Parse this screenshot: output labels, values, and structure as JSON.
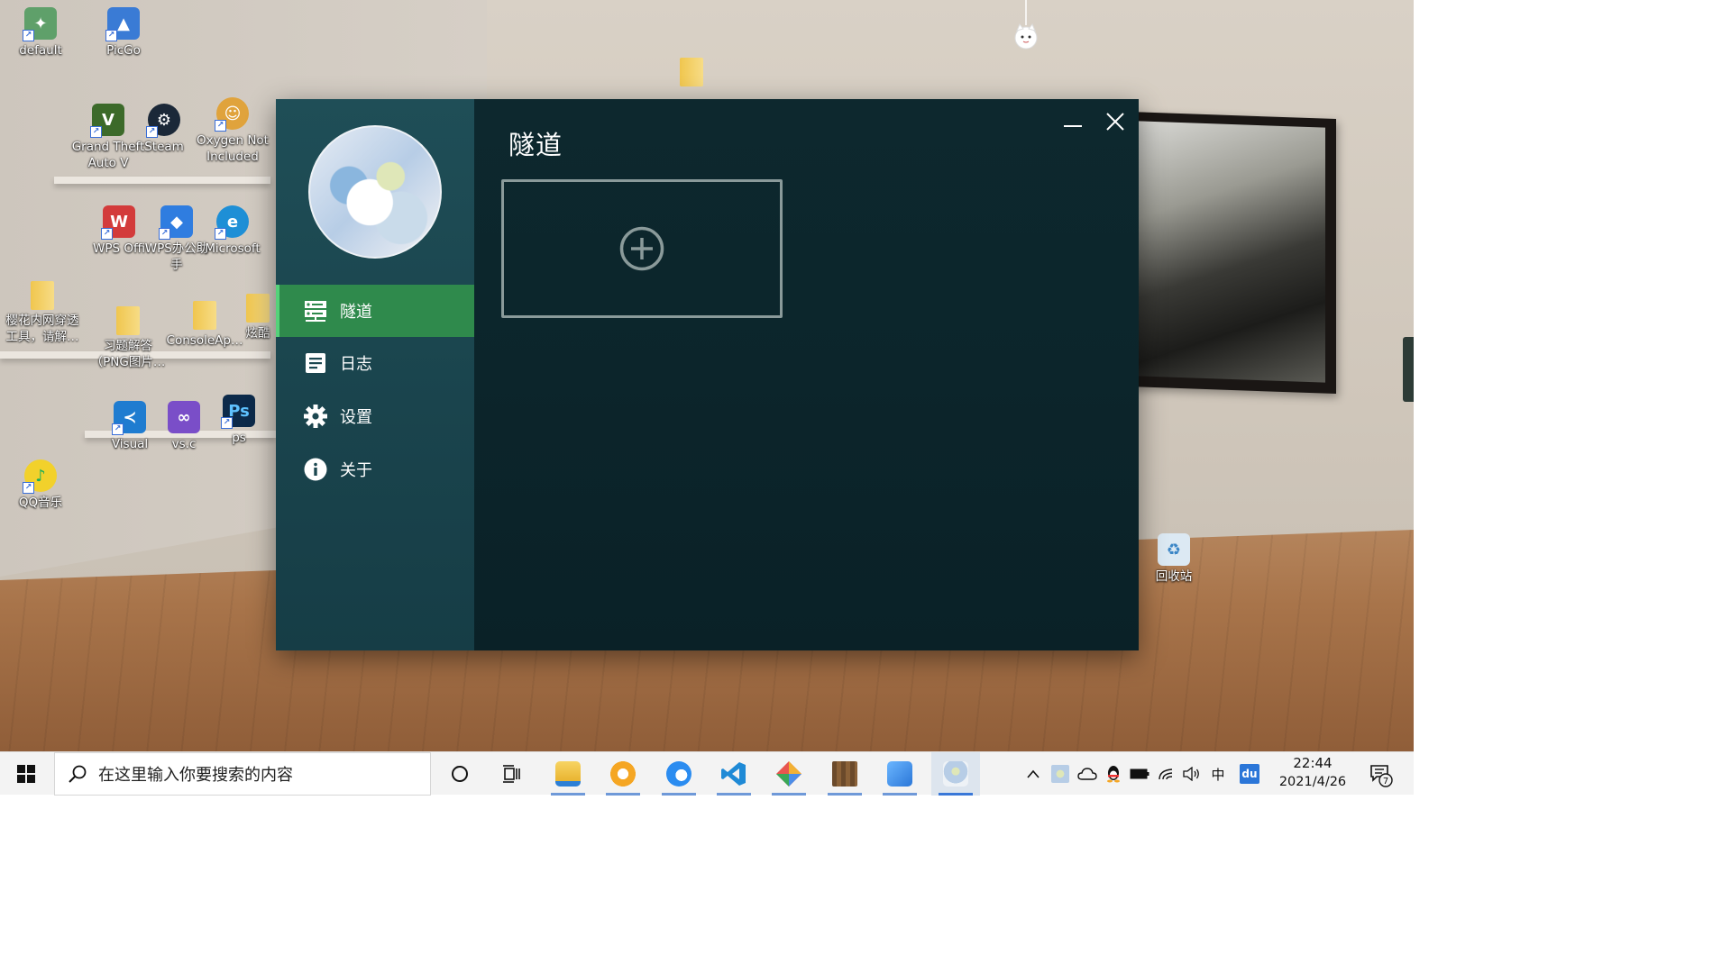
{
  "desktop": {
    "icons": [
      {
        "label": "default",
        "color": "#5fa06a"
      },
      {
        "label": "PicGo",
        "color": "#3a7bd5"
      },
      {
        "label": "Grand Theft Auto V",
        "color": "#3c6a2a"
      },
      {
        "label": "Steam",
        "color": "#1b2838"
      },
      {
        "label": "Oxygen Not Included",
        "color": "#e0a33c"
      },
      {
        "label": "WPS Offi",
        "color": "#d33b3b"
      },
      {
        "label": "WPS办公助手",
        "color": "#2f7de0"
      },
      {
        "label": "Microsoft",
        "color": "#1e8fd6"
      },
      {
        "label": "樱花内网穿透工具，请解…",
        "color": "#f3cf6b"
      },
      {
        "label": "习题解答（PNG图片…",
        "color": "#f3cf6b"
      },
      {
        "label": "ConsoleAp…",
        "color": "#f3cf6b"
      },
      {
        "label": "炫酷",
        "color": "#f3cf6b"
      },
      {
        "label": "Visual",
        "color": "#1f7cd0"
      },
      {
        "label": "vs.c",
        "color": "#7a4ec8"
      },
      {
        "label": "ps",
        "color": "#0c2a4a"
      },
      {
        "label": "QQ音乐",
        "color": "#f2d12b"
      },
      {
        "label": "回收站",
        "color": "#cfe3f2"
      }
    ]
  },
  "app": {
    "page_title": "隧道",
    "nav": [
      {
        "label": "隧道",
        "icon": "server-icon",
        "active": true
      },
      {
        "label": "日志",
        "icon": "document-icon",
        "active": false
      },
      {
        "label": "设置",
        "icon": "gear-icon",
        "active": false
      },
      {
        "label": "关于",
        "icon": "info-icon",
        "active": false
      }
    ],
    "colors": {
      "sidebar": "#1f4e57",
      "main": "#0c252b",
      "accent_active": "#2f8a4c",
      "card_border": "#8a9a9a"
    }
  },
  "taskbar": {
    "search_placeholder": "在这里输入你要搜索的内容",
    "apps": [
      "file-explorer",
      "qq-browser",
      "edge",
      "vscode",
      "sourcetree",
      "minecraft",
      "picgo",
      "avatar-app"
    ],
    "tray": {
      "ime": "中",
      "baidu": "du",
      "time": "22:44",
      "date": "2021/4/26",
      "notification_count": "7"
    }
  }
}
